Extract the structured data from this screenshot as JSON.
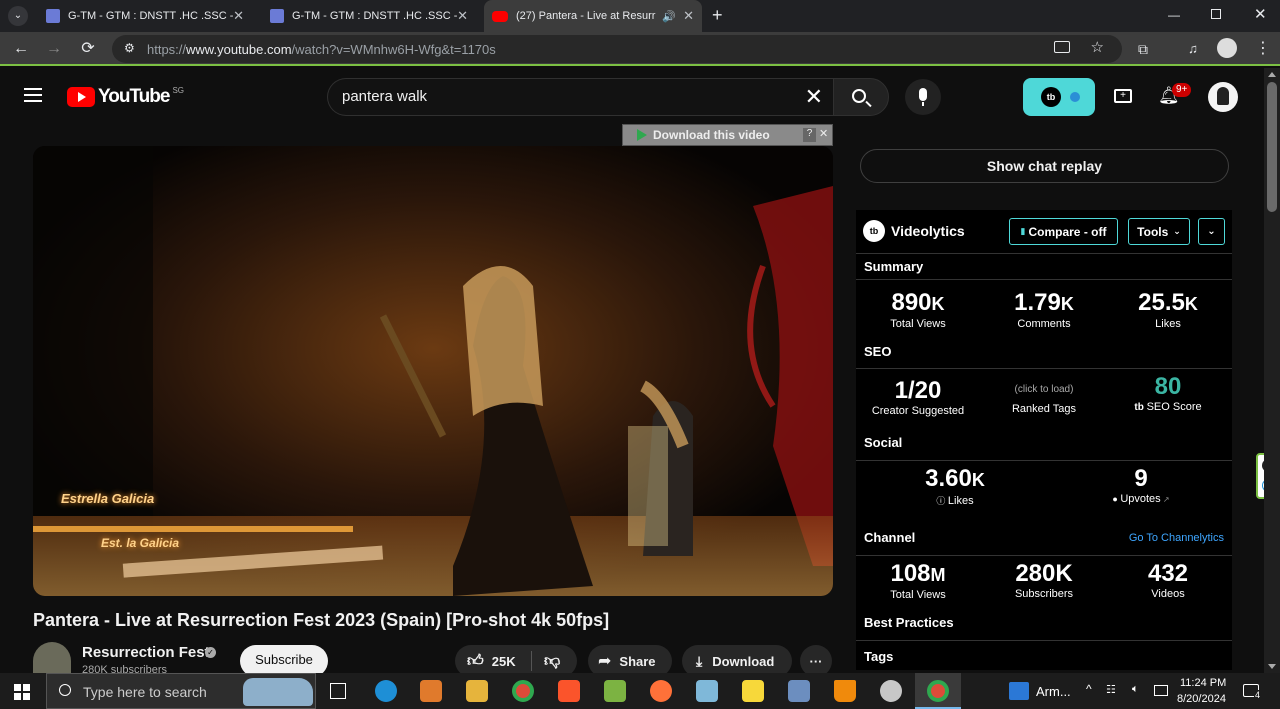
{
  "browser": {
    "tabs": [
      {
        "title": "G-TM - GTM : DNSTT .HC .SSC -"
      },
      {
        "title": "G-TM - GTM : DNSTT .HC .SSC -"
      },
      {
        "title": "(27) Pantera - Live at Resurr"
      }
    ],
    "new_tab": "+",
    "url_prefix": "https://",
    "url_domain": "www.youtube.com",
    "url_path": "/watch?v=WMnhw6H-Wfg&t=1170s"
  },
  "youtube": {
    "logo": "YouTube",
    "region": "SG",
    "search_value": "pantera walk",
    "notif_count": "9+",
    "download_bar": "Download this video",
    "download_help": "?",
    "download_close": "✕",
    "video_overlay_sign1": "Estrella Galicia",
    "video_overlay_sign2": "Est. la Galicia",
    "video_title": "Pantera - Live at Resurrection Fest 2023 (Spain) [Pro-shot 4k 50fps]",
    "channel_name": "Resurrection Fest",
    "channel_subs": "280K subscribers",
    "subscribe": "Subscribe",
    "likes": "25K",
    "share": "Share",
    "download": "Download",
    "more": "···",
    "chat_replay": "Show chat replay"
  },
  "videolytics": {
    "title": "Videolytics",
    "compare": "Compare - off",
    "tools": "Tools",
    "summary_label": "Summary",
    "summary": [
      {
        "value": "890",
        "unit": "K",
        "label": "Total Views"
      },
      {
        "value": "1.79",
        "unit": "K",
        "label": "Comments"
      },
      {
        "value": "25.5",
        "unit": "K",
        "label": "Likes"
      }
    ],
    "seo_label": "SEO",
    "seo_creator": {
      "value": "1/20",
      "label": "Creator Suggested"
    },
    "seo_ranked": {
      "value": "(click to load)",
      "label": "Ranked Tags"
    },
    "seo_score": {
      "value": "80",
      "label": "SEO Score"
    },
    "social_label": "Social",
    "social_likes": {
      "value": "3.60",
      "unit": "K",
      "label": "Likes"
    },
    "social_upvotes": {
      "value": "9",
      "label": "Upvotes"
    },
    "channel_label": "Channel",
    "channel_link": "Go To Channelytics",
    "channel": [
      {
        "value": "108",
        "unit": "M",
        "label": "Total Views"
      },
      {
        "value": "280K",
        "unit": "",
        "label": "Subscribers"
      },
      {
        "value": "432",
        "unit": "",
        "label": "Videos"
      }
    ],
    "best_practices": "Best Practices",
    "tags": "Tags"
  },
  "taskbar": {
    "search_placeholder": "Type here to search",
    "tray_app": "Arm...",
    "time": "11:24 PM",
    "date": "8/20/2024",
    "notif": "4"
  },
  "colors": {
    "accent_teal": "#4ed8d8",
    "yt_red": "#ff0000",
    "seo_green": "#3bb5a3",
    "link_blue": "#3ea6ff"
  }
}
